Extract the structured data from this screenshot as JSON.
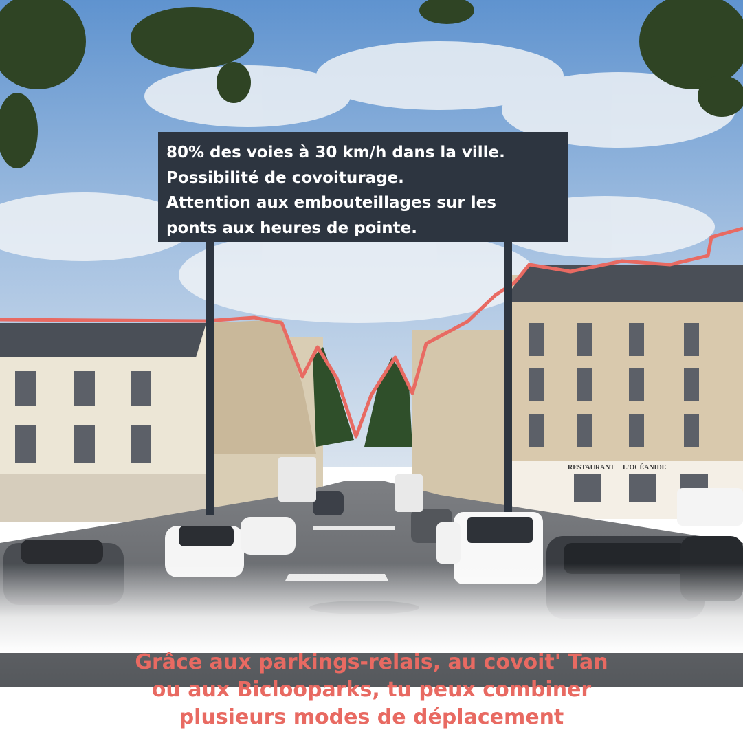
{
  "sign": {
    "lines": [
      "80% des voies à 30 km/h dans la ville.",
      "Possibilité de covoiturage.",
      "Attention aux embouteillages sur les",
      "ponts aux heures de pointe."
    ]
  },
  "caption": {
    "lines": [
      "Grâce aux parkings-relais, au covoit' Tan",
      "ou aux Biclooparks, tu peux combiner",
      "plusieurs modes de déplacement"
    ]
  },
  "storefront": {
    "restaurant": "RESTAURANT",
    "name": "L'OCÉANIDE"
  },
  "colors": {
    "accent": "#e86a62",
    "sign_bg": "#2d3540",
    "sky": "#7fa9d8"
  }
}
